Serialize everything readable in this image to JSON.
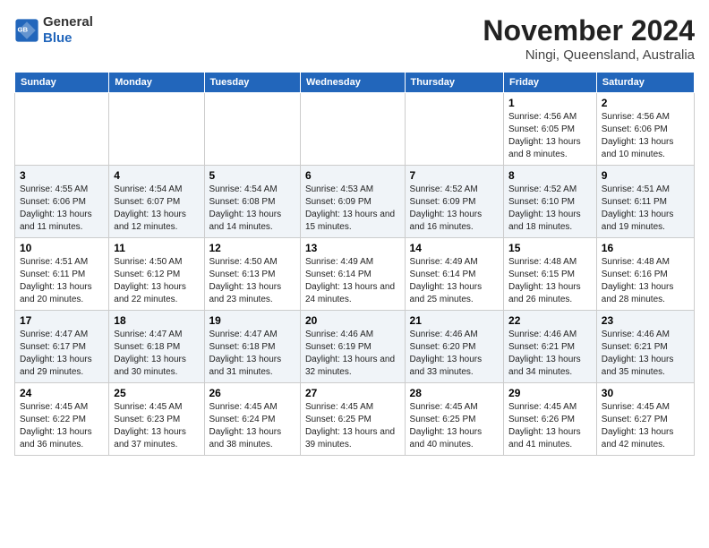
{
  "logo": {
    "line1": "General",
    "line2": "Blue"
  },
  "title": "November 2024",
  "location": "Ningi, Queensland, Australia",
  "days_of_week": [
    "Sunday",
    "Monday",
    "Tuesday",
    "Wednesday",
    "Thursday",
    "Friday",
    "Saturday"
  ],
  "weeks": [
    [
      {
        "day": "",
        "info": ""
      },
      {
        "day": "",
        "info": ""
      },
      {
        "day": "",
        "info": ""
      },
      {
        "day": "",
        "info": ""
      },
      {
        "day": "",
        "info": ""
      },
      {
        "day": "1",
        "info": "Sunrise: 4:56 AM\nSunset: 6:05 PM\nDaylight: 13 hours and 8 minutes."
      },
      {
        "day": "2",
        "info": "Sunrise: 4:56 AM\nSunset: 6:06 PM\nDaylight: 13 hours and 10 minutes."
      }
    ],
    [
      {
        "day": "3",
        "info": "Sunrise: 4:55 AM\nSunset: 6:06 PM\nDaylight: 13 hours and 11 minutes."
      },
      {
        "day": "4",
        "info": "Sunrise: 4:54 AM\nSunset: 6:07 PM\nDaylight: 13 hours and 12 minutes."
      },
      {
        "day": "5",
        "info": "Sunrise: 4:54 AM\nSunset: 6:08 PM\nDaylight: 13 hours and 14 minutes."
      },
      {
        "day": "6",
        "info": "Sunrise: 4:53 AM\nSunset: 6:09 PM\nDaylight: 13 hours and 15 minutes."
      },
      {
        "day": "7",
        "info": "Sunrise: 4:52 AM\nSunset: 6:09 PM\nDaylight: 13 hours and 16 minutes."
      },
      {
        "day": "8",
        "info": "Sunrise: 4:52 AM\nSunset: 6:10 PM\nDaylight: 13 hours and 18 minutes."
      },
      {
        "day": "9",
        "info": "Sunrise: 4:51 AM\nSunset: 6:11 PM\nDaylight: 13 hours and 19 minutes."
      }
    ],
    [
      {
        "day": "10",
        "info": "Sunrise: 4:51 AM\nSunset: 6:11 PM\nDaylight: 13 hours and 20 minutes."
      },
      {
        "day": "11",
        "info": "Sunrise: 4:50 AM\nSunset: 6:12 PM\nDaylight: 13 hours and 22 minutes."
      },
      {
        "day": "12",
        "info": "Sunrise: 4:50 AM\nSunset: 6:13 PM\nDaylight: 13 hours and 23 minutes."
      },
      {
        "day": "13",
        "info": "Sunrise: 4:49 AM\nSunset: 6:14 PM\nDaylight: 13 hours and 24 minutes."
      },
      {
        "day": "14",
        "info": "Sunrise: 4:49 AM\nSunset: 6:14 PM\nDaylight: 13 hours and 25 minutes."
      },
      {
        "day": "15",
        "info": "Sunrise: 4:48 AM\nSunset: 6:15 PM\nDaylight: 13 hours and 26 minutes."
      },
      {
        "day": "16",
        "info": "Sunrise: 4:48 AM\nSunset: 6:16 PM\nDaylight: 13 hours and 28 minutes."
      }
    ],
    [
      {
        "day": "17",
        "info": "Sunrise: 4:47 AM\nSunset: 6:17 PM\nDaylight: 13 hours and 29 minutes."
      },
      {
        "day": "18",
        "info": "Sunrise: 4:47 AM\nSunset: 6:18 PM\nDaylight: 13 hours and 30 minutes."
      },
      {
        "day": "19",
        "info": "Sunrise: 4:47 AM\nSunset: 6:18 PM\nDaylight: 13 hours and 31 minutes."
      },
      {
        "day": "20",
        "info": "Sunrise: 4:46 AM\nSunset: 6:19 PM\nDaylight: 13 hours and 32 minutes."
      },
      {
        "day": "21",
        "info": "Sunrise: 4:46 AM\nSunset: 6:20 PM\nDaylight: 13 hours and 33 minutes."
      },
      {
        "day": "22",
        "info": "Sunrise: 4:46 AM\nSunset: 6:21 PM\nDaylight: 13 hours and 34 minutes."
      },
      {
        "day": "23",
        "info": "Sunrise: 4:46 AM\nSunset: 6:21 PM\nDaylight: 13 hours and 35 minutes."
      }
    ],
    [
      {
        "day": "24",
        "info": "Sunrise: 4:45 AM\nSunset: 6:22 PM\nDaylight: 13 hours and 36 minutes."
      },
      {
        "day": "25",
        "info": "Sunrise: 4:45 AM\nSunset: 6:23 PM\nDaylight: 13 hours and 37 minutes."
      },
      {
        "day": "26",
        "info": "Sunrise: 4:45 AM\nSunset: 6:24 PM\nDaylight: 13 hours and 38 minutes."
      },
      {
        "day": "27",
        "info": "Sunrise: 4:45 AM\nSunset: 6:25 PM\nDaylight: 13 hours and 39 minutes."
      },
      {
        "day": "28",
        "info": "Sunrise: 4:45 AM\nSunset: 6:25 PM\nDaylight: 13 hours and 40 minutes."
      },
      {
        "day": "29",
        "info": "Sunrise: 4:45 AM\nSunset: 6:26 PM\nDaylight: 13 hours and 41 minutes."
      },
      {
        "day": "30",
        "info": "Sunrise: 4:45 AM\nSunset: 6:27 PM\nDaylight: 13 hours and 42 minutes."
      }
    ]
  ]
}
